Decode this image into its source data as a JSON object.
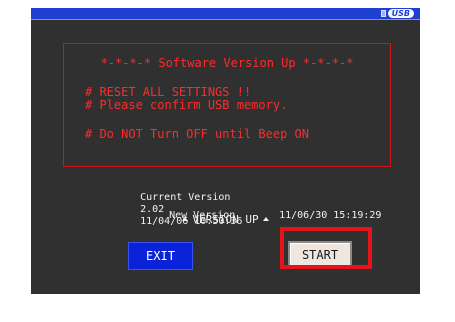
{
  "status_bar": {
    "usb_label": "USB"
  },
  "message": {
    "title": "*-*-*-* Software Version Up *-*-*-*",
    "line1": "# RESET ALL SETTINGS !!",
    "line2": "# Please confirm USB memory.",
    "line3": "# Do NOT Turn OFF until Beep ON"
  },
  "versions": {
    "current_label": "Current Version",
    "current_version": "2.02",
    "current_datetime": "11/04/06 10:50:36",
    "new_label": "New Version",
    "new_datetime": "11/06/30 15:19:29"
  },
  "version_up_label": "VERSION UP",
  "buttons": {
    "exit_label": "EXIT",
    "start_label": "START"
  },
  "colors": {
    "screen_bg": "#303030",
    "title_bar": "#1f3fd2",
    "message_text": "#ff2b2b",
    "exit_button": "#0b23d8",
    "start_button": "#efe6df",
    "highlight": "#e5141b"
  }
}
